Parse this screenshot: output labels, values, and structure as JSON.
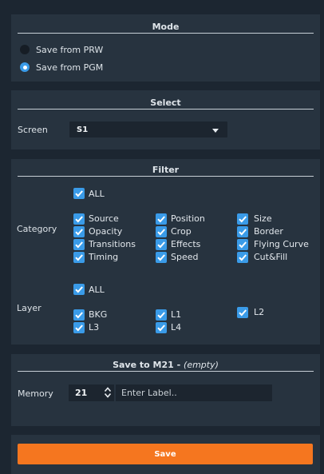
{
  "colors": {
    "accent_blue": "#3a9be8",
    "save_orange": "#f5761f",
    "panel_bg": "#27333f",
    "page_bg": "#1c2631"
  },
  "mode": {
    "title": "Mode",
    "options": [
      {
        "label": "Save from PRW",
        "selected": false
      },
      {
        "label": "Save from PGM",
        "selected": true
      }
    ]
  },
  "select": {
    "title": "Select",
    "screen_label": "Screen",
    "screen_value": "S1"
  },
  "filter": {
    "title": "Filter",
    "category_label": "Category",
    "category_all": "ALL",
    "categories": [
      "Source",
      "Position",
      "Size",
      "Opacity",
      "Crop",
      "Border",
      "Transitions",
      "Effects",
      "Flying Curve",
      "Timing",
      "Speed",
      "Cut&Fill"
    ],
    "layer_label": "Layer",
    "layer_all": "ALL",
    "layers": [
      "BKG",
      "L1",
      "L2",
      "L3",
      "L4"
    ]
  },
  "memory": {
    "title_main": "Save to M21 -",
    "title_status": "(empty)",
    "memory_label": "Memory",
    "memory_value": "21",
    "label_placeholder": "Enter Label.."
  },
  "save_label": "Save"
}
